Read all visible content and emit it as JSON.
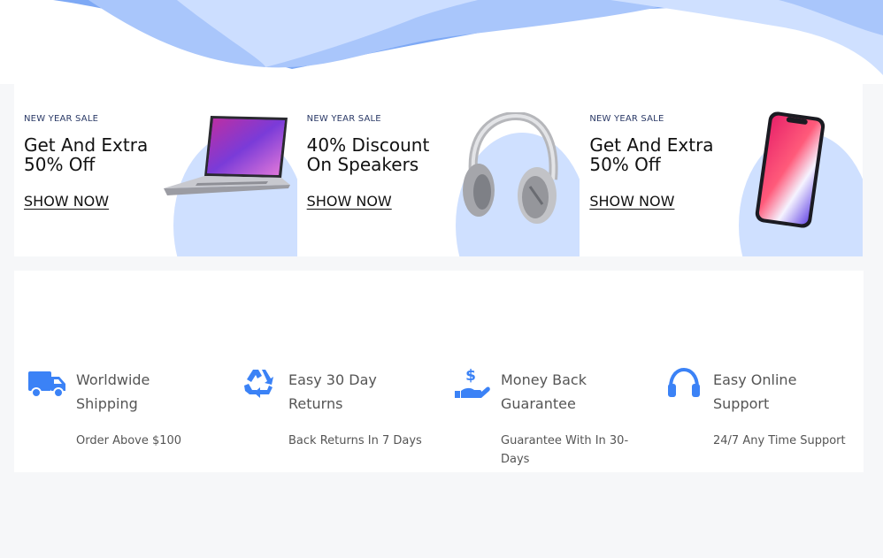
{
  "colors": {
    "accent": "#3b82f6",
    "wave_light": "#cfe0ff",
    "wave_mid": "#a9c6fb",
    "wave_dark": "#7ea9f5",
    "card_blob": "#cfe0ff"
  },
  "promos": [
    {
      "tag": "NEW YEAR SALE",
      "headline": "Get And Extra 50% Off",
      "cta": "SHOW NOW",
      "product": "laptop-image"
    },
    {
      "tag": "NEW YEAR SALE",
      "headline": "40% Discount On Speakers",
      "cta": "SHOW NOW",
      "product": "headphones-image"
    },
    {
      "tag": "NEW YEAR SALE",
      "headline": "Get And Extra 50% Off",
      "cta": "SHOW NOW",
      "product": "phone-image"
    }
  ],
  "features": [
    {
      "icon": "truck-icon",
      "title": "Worldwide Shipping",
      "subtitle": "Order Above $100"
    },
    {
      "icon": "recycle-icon",
      "title": "Easy 30 Day Returns",
      "subtitle": "Back Returns In 7 Days"
    },
    {
      "icon": "money-hand-icon",
      "title": "Money Back Guarantee",
      "subtitle": "Guarantee With In 30-Days"
    },
    {
      "icon": "headset-icon",
      "title": "Easy Online Support",
      "subtitle": "24/7 Any Time Support"
    }
  ]
}
